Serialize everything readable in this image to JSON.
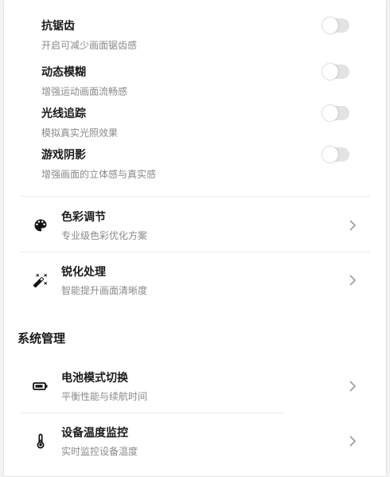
{
  "toggles": [
    {
      "title": "抗锯齿",
      "desc": "开启可减少画面锯齿感"
    },
    {
      "title": "动态模糊",
      "desc": "增强运动画面流畅感"
    },
    {
      "title": "光线追踪",
      "desc": "模拟真实光照效果"
    },
    {
      "title": "游戏阴影",
      "desc": "增强画面的立体感与真实感"
    }
  ],
  "display_items": [
    {
      "title": "色彩调节",
      "desc": "专业级色彩优化方案",
      "icon": "palette-icon"
    },
    {
      "title": "锐化处理",
      "desc": "智能提升画面清晰度",
      "icon": "magic-wand-icon"
    }
  ],
  "system_section": {
    "title": "系统管理",
    "items": [
      {
        "title": "电池模式切换",
        "desc": "平衡性能与续航时间",
        "icon": "battery-icon"
      },
      {
        "title": "设备温度监控",
        "desc": "实时监控设备温度",
        "icon": "thermometer-icon"
      }
    ]
  },
  "colors": {
    "switch_off": "#e3e3e3",
    "muted_text": "#8a8a8a",
    "divider": "#ececec"
  }
}
